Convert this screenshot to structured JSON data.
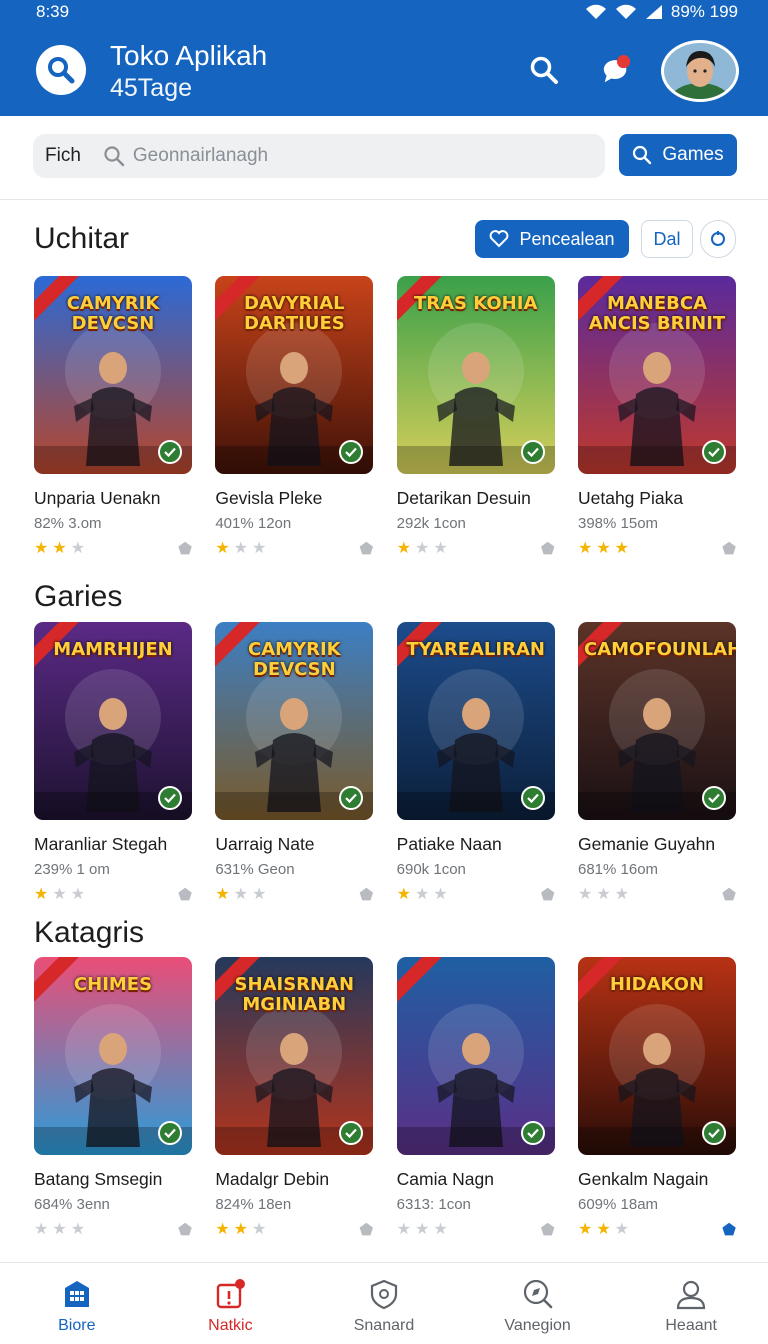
{
  "status": {
    "time": "8:39",
    "battery_text": "89% 199"
  },
  "app_bar": {
    "title": "Toko Aplikah",
    "subtitle": "45Tage",
    "logo_icon": "search-icon",
    "actions": [
      "search-icon",
      "chat-bubble-icon"
    ],
    "accent_color": "#1565c0"
  },
  "search": {
    "prefix": "Fich",
    "placeholder": "Geonnairlanagh",
    "button_label": "Games"
  },
  "sections": [
    {
      "title": "Uchitar",
      "actions": {
        "primary_label": "Pencealean",
        "secondary_label": "Dal"
      },
      "cards": [
        {
          "name": "Unparia Uenakn",
          "meta": "82% 3.om",
          "thumb_title": "CAMYRIK DEVCSN",
          "rating": 2,
          "saved": false,
          "colors": [
            "#2b6ad6",
            "#b7452a"
          ]
        },
        {
          "name": "Gevisla Pleke",
          "meta": "401% 12on",
          "thumb_title": "DAVYRIAL DARTIUES",
          "rating": 1,
          "saved": false,
          "colors": [
            "#c8431a",
            "#401208"
          ]
        },
        {
          "name": "Detarikan Desuin",
          "meta": "292k 1con",
          "thumb_title": "TRAS KOHIA",
          "rating": 1,
          "saved": false,
          "colors": [
            "#3aa04a",
            "#d6cf5a"
          ]
        },
        {
          "name": "Uetahg Piaka",
          "meta": "398% 15om",
          "thumb_title": "MANEBCA ANCIS BRINIT",
          "rating": 3,
          "saved": false,
          "colors": [
            "#5a2a9c",
            "#c0392b"
          ]
        }
      ]
    },
    {
      "title": "Garies",
      "cards": [
        {
          "name": "Maranliar Stegah",
          "meta": "239% 1 om",
          "thumb_title": "MAMRHIJEN",
          "rating": 1,
          "saved": false,
          "colors": [
            "#5b2a86",
            "#1d1230"
          ]
        },
        {
          "name": "Uarraig Nate",
          "meta": "631% Geon",
          "thumb_title": "CAMYRIK DEVCSN",
          "rating": 1,
          "saved": false,
          "colors": [
            "#3c7fc4",
            "#7a5a2a"
          ]
        },
        {
          "name": "Patiake Naan",
          "meta": "690k 1con",
          "thumb_title": "TYAREALIRAN",
          "rating": 1,
          "saved": false,
          "colors": [
            "#1d4c8c",
            "#0b1f3a"
          ]
        },
        {
          "name": "Gemanie Guyahn",
          "meta": "681% 16om",
          "thumb_title": "CAMOFOUNLAH",
          "rating": 0,
          "saved": false,
          "colors": [
            "#5c3428",
            "#1a1014"
          ]
        }
      ]
    },
    {
      "title": "Katagris",
      "cards": [
        {
          "name": "Batang Smsegin",
          "meta": "684% 3enn",
          "thumb_title": "CHIMES",
          "rating": 0,
          "saved": false,
          "colors": [
            "#e94e77",
            "#2b9cd8"
          ]
        },
        {
          "name": "Madalgr Debin",
          "meta": "824% 18en",
          "thumb_title": "SHAISRNAN MGINIABN",
          "rating": 2,
          "saved": false,
          "colors": [
            "#24395c",
            "#b5341c"
          ]
        },
        {
          "name": "Camia Nagn",
          "meta": "6313: 1con",
          "thumb_title": "",
          "rating": 0,
          "saved": false,
          "colors": [
            "#1f5fa3",
            "#5a2f86"
          ]
        },
        {
          "name": "Genkalm Nagain",
          "meta": "609% 18am",
          "thumb_title": "HIDAKON",
          "rating": 2,
          "saved": true,
          "colors": [
            "#b83214",
            "#2a0d08"
          ]
        }
      ]
    }
  ],
  "bottom_nav": [
    {
      "label": "Biore",
      "icon": "store-icon",
      "state": "active"
    },
    {
      "label": "Natkic",
      "icon": "notification-box-icon",
      "state": "alert"
    },
    {
      "label": "Snanard",
      "icon": "shield-icon",
      "state": ""
    },
    {
      "label": "Vanegion",
      "icon": "compass-icon",
      "state": ""
    },
    {
      "label": "Heaant",
      "icon": "profile-icon",
      "state": ""
    }
  ]
}
